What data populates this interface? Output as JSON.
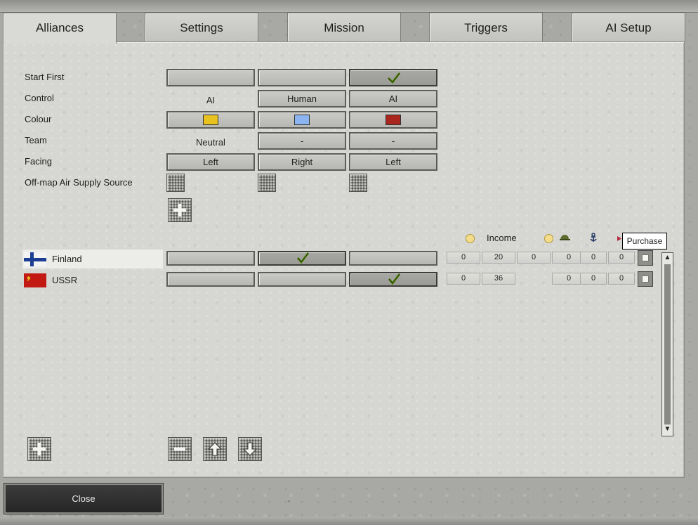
{
  "tabs": [
    {
      "label": "Alliances",
      "active": true
    },
    {
      "label": "Settings",
      "active": false
    },
    {
      "label": "Mission",
      "active": false
    },
    {
      "label": "Triggers",
      "active": false
    },
    {
      "label": "AI Setup",
      "active": false
    }
  ],
  "properties": {
    "start_first": "Start First",
    "control": "Control",
    "colour": "Colour",
    "team": "Team",
    "facing": "Facing",
    "airsupply": "Off-map Air Supply Source"
  },
  "columns": [
    {
      "start_first": false,
      "control": "AI",
      "colour": "#e8c21e",
      "team": "Neutral",
      "facing": "Left"
    },
    {
      "start_first": false,
      "control": "Human",
      "colour": "#8cb4f0",
      "team": "-",
      "facing": "Right"
    },
    {
      "start_first": true,
      "control": "AI",
      "colour": "#a8261e",
      "team": "-",
      "facing": "Left"
    }
  ],
  "resource_header": {
    "income_label": "Income",
    "tooltip": "Purchase",
    "icons": [
      "coin-icon",
      "coin-icon",
      "helmet-icon",
      "anchor-icon",
      "flag-marker-icon"
    ]
  },
  "factions": [
    {
      "name": "Finland",
      "flag": "finland-flag",
      "selected": true,
      "alliance_col": 1,
      "values": [
        "0",
        "20",
        "0",
        "0",
        "0",
        "0"
      ]
    },
    {
      "name": "USSR",
      "flag": "ussr-flag",
      "selected": false,
      "alliance_col": 2,
      "values": [
        "0",
        "36",
        "",
        "0",
        "0",
        "0"
      ]
    }
  ],
  "footer": {
    "close_label": "Close",
    "mark": "-"
  },
  "colors": {
    "check_green": "#5a8a10",
    "panel": "#d6d6d2",
    "close_bg": "#2e2e2e"
  }
}
